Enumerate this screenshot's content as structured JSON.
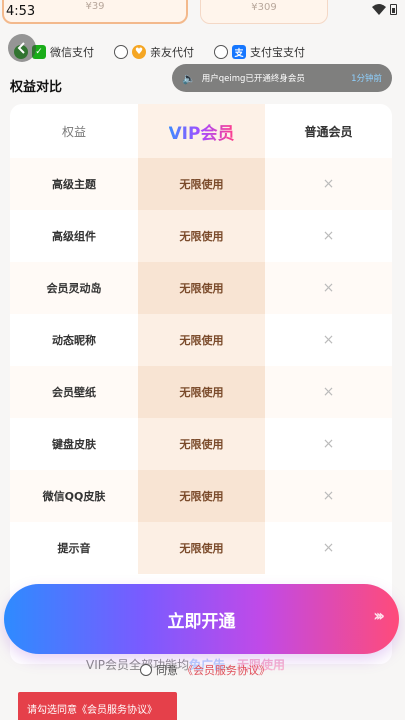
{
  "status": {
    "time": "4:53"
  },
  "prices": {
    "card1": "¥39",
    "card2": "¥309"
  },
  "payment": {
    "wechat": "微信支付",
    "friend": "亲友代付",
    "alipay": "支付宝支付"
  },
  "notice": {
    "text": "用户qeimg已开通终身会员",
    "time": "1分钟前"
  },
  "section_title": "权益对比",
  "table": {
    "header": {
      "col1": "权益",
      "col2": "VIP会员",
      "col3": "普通会员"
    },
    "rows": [
      {
        "name": "高级主题",
        "vip": "无限使用",
        "normal": "×"
      },
      {
        "name": "高级组件",
        "vip": "无限使用",
        "normal": "×"
      },
      {
        "name": "会员灵动岛",
        "vip": "无限使用",
        "normal": "×"
      },
      {
        "name": "动态昵称",
        "vip": "无限使用",
        "normal": "×"
      },
      {
        "name": "会员壁纸",
        "vip": "无限使用",
        "normal": "×"
      },
      {
        "name": "键盘皮肤",
        "vip": "无限使用",
        "normal": "×"
      },
      {
        "name": "微信QQ皮肤",
        "vip": "无限使用",
        "normal": "×"
      },
      {
        "name": "提示音",
        "vip": "无限使用",
        "normal": "×"
      }
    ]
  },
  "cta": {
    "label": "立即开通",
    "arrows": "›››"
  },
  "promo": {
    "text": "VIP会员全部功能均",
    "free_ads": "免广告",
    "sep": "、",
    "unlimited": "无限使用"
  },
  "agreement": {
    "prefix": "同意",
    "link": "《会员服务协议》"
  },
  "toast": {
    "text": "请勾选同意《会员服务协议》"
  }
}
